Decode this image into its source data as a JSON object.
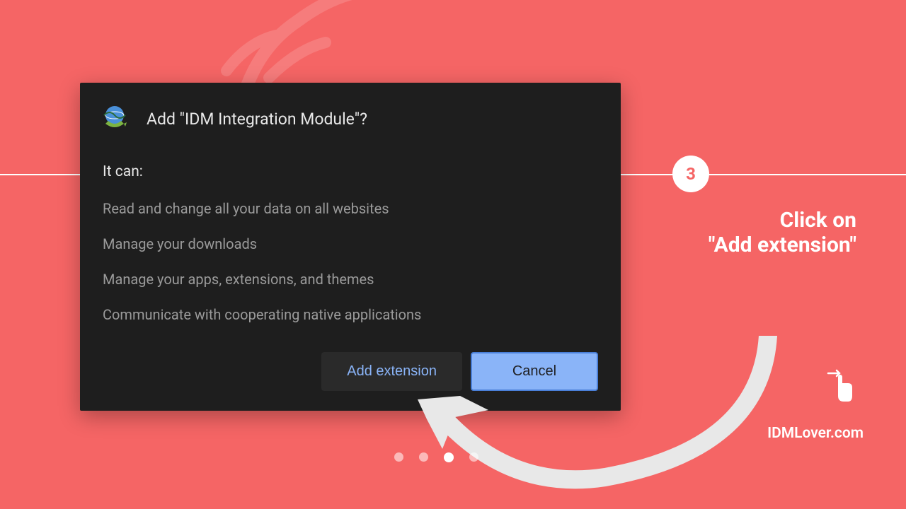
{
  "dialog": {
    "title": "Add \"IDM Integration Module\"?",
    "permissions_label": "It can:",
    "permissions": [
      "Read and change all your data on all websites",
      "Manage your downloads",
      "Manage your apps, extensions, and themes",
      "Communicate with cooperating native applications"
    ],
    "buttons": {
      "add": "Add extension",
      "cancel": "Cancel"
    }
  },
  "step": {
    "number": "3",
    "instruction_line1": "Click on",
    "instruction_line2": "\"Add extension\""
  },
  "brand": "IDMLover.com"
}
